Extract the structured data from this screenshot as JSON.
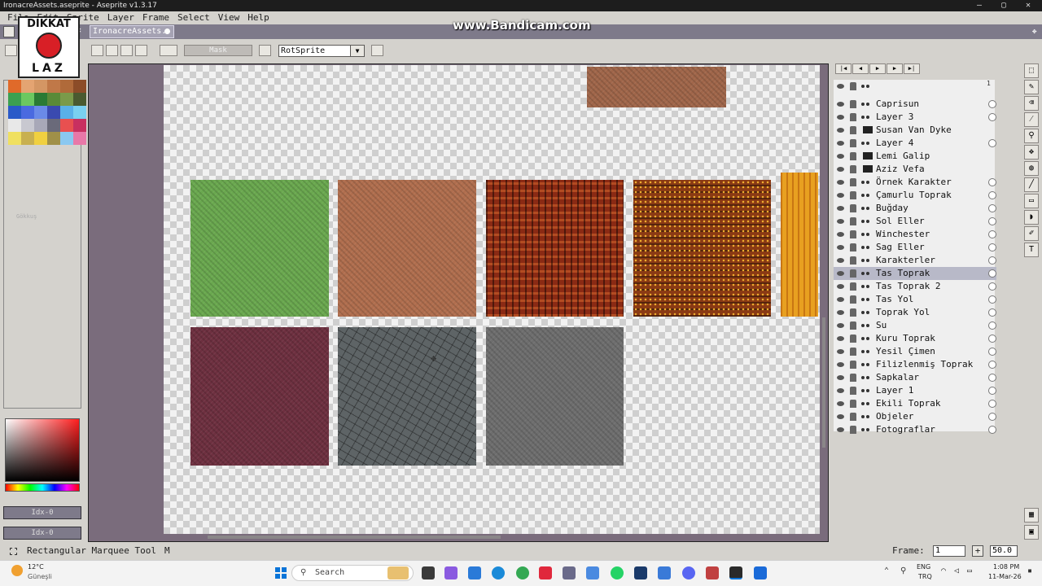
{
  "window": {
    "title": "IronacreAssets.aseprite - Aseprite v1.3.17"
  },
  "menu": [
    "File",
    "Edit",
    "Sprite",
    "Layer",
    "Frame",
    "Select",
    "View",
    "Help"
  ],
  "tab": {
    "label": "IronacreAssets."
  },
  "toolbar": {
    "mask_label": "Mask",
    "rotation_algorithm": "RotSprite"
  },
  "watermark": "www.Bandicam.com",
  "logo": {
    "top": "DİKKAT",
    "bottom": "LAZ"
  },
  "palette_colors": [
    "#e06a2a",
    "#e4a472",
    "#d49664",
    "#c07848",
    "#b06a3a",
    "#8c4c28",
    "#3ca050",
    "#6cc860",
    "#2a7a34",
    "#5a8a38",
    "#7a9a4a",
    "#4a5a30",
    "#2a5ac8",
    "#4a6ae0",
    "#6a8ae8",
    "#3a4ab0",
    "#5ab0e8",
    "#7ad0f0",
    "#e8e8e8",
    "#c8c8d0",
    "#a8a8b8",
    "#6a6a7a",
    "#e85050",
    "#c83060",
    "#f0e060",
    "#c8b050",
    "#f0d040",
    "#a09048",
    "#8ac8f0",
    "#e878a8"
  ],
  "ghost_label": "Gökkuş",
  "idx": [
    "Idx-0",
    "Idx-0"
  ],
  "layers": [
    {
      "name": "",
      "type": "header"
    },
    {
      "name": "Caprisun",
      "type": "layer"
    },
    {
      "name": "Layer 3",
      "type": "layer"
    },
    {
      "name": "Susan Van Dyke",
      "type": "group"
    },
    {
      "name": "Layer 4",
      "type": "layer"
    },
    {
      "name": "Lemi Galip",
      "type": "group"
    },
    {
      "name": "Aziz Vefa",
      "type": "group"
    },
    {
      "name": "Örnek Karakter",
      "type": "layer"
    },
    {
      "name": "Çamurlu Toprak",
      "type": "layer"
    },
    {
      "name": "Buğday",
      "type": "layer"
    },
    {
      "name": "Sol Eller",
      "type": "layer"
    },
    {
      "name": "Winchester",
      "type": "layer"
    },
    {
      "name": "Sag Eller",
      "type": "layer"
    },
    {
      "name": "Karakterler",
      "type": "layer"
    },
    {
      "name": "Tas Toprak",
      "type": "layer",
      "selected": true
    },
    {
      "name": "Tas Toprak 2",
      "type": "layer"
    },
    {
      "name": "Tas Yol",
      "type": "layer"
    },
    {
      "name": "Toprak Yol",
      "type": "layer"
    },
    {
      "name": "Su",
      "type": "layer"
    },
    {
      "name": "Kuru Toprak",
      "type": "layer"
    },
    {
      "name": "Yesil Çimen",
      "type": "layer"
    },
    {
      "name": "Filizlenmiş Toprak",
      "type": "layer"
    },
    {
      "name": "Sapkalar",
      "type": "layer"
    },
    {
      "name": "Layer 1",
      "type": "layer"
    },
    {
      "name": "Ekili Toprak",
      "type": "layer"
    },
    {
      "name": "Objeler",
      "type": "layer"
    },
    {
      "name": "Fotograflar",
      "type": "layer"
    }
  ],
  "frame_header": "1",
  "status": {
    "tool": "Rectangular Marquee Tool",
    "shortcut": "M",
    "frame_label": "Frame:",
    "frame_value": "1",
    "zoom": "50.0"
  },
  "taskbar": {
    "weather_temp": "12°C",
    "weather_loc": "Güneşli",
    "search": "Search",
    "lang": "ENG",
    "region": "TRQ",
    "time": "1:08 PM",
    "date": "11-Mar-26"
  },
  "tile_colors": {
    "grass": "#6aa84f",
    "dirt": "#b06e4e",
    "tilled": "#8a2a14",
    "seeded": "#8a3a14",
    "wheat": "#e8a020",
    "mud": "#6e3040",
    "stone_dark": "#5e6466",
    "stone": "#6e6e6e",
    "topdirt": "#a0664a"
  }
}
